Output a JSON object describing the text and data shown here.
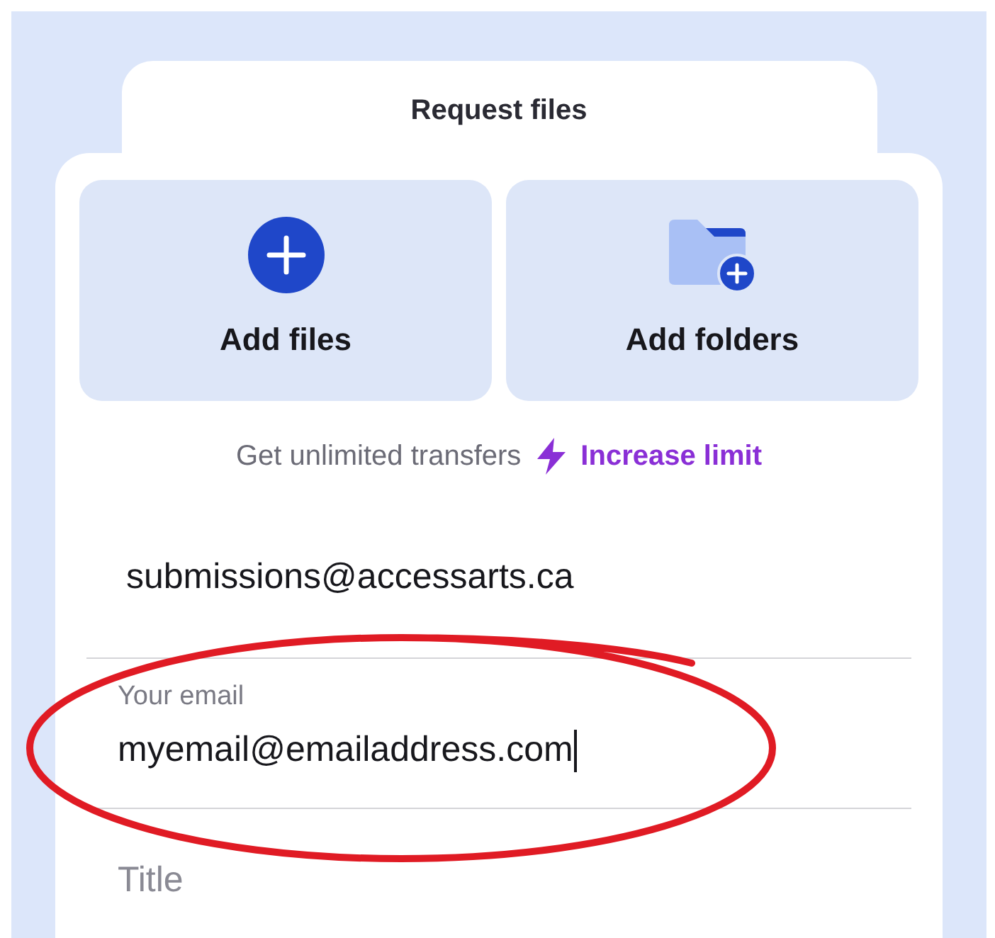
{
  "tab": {
    "label": "Request files"
  },
  "upload_options": [
    {
      "kind": "files",
      "label": "Add files"
    },
    {
      "kind": "folders",
      "label": "Add folders"
    }
  ],
  "promo": {
    "text": "Get unlimited transfers",
    "link": "Increase limit"
  },
  "form": {
    "recipient": {
      "value": "submissions@accessarts.ca"
    },
    "sender": {
      "label": "Your email",
      "value": "myemail@emailaddress.com",
      "focused": true
    },
    "title": {
      "placeholder": "Title"
    }
  }
}
